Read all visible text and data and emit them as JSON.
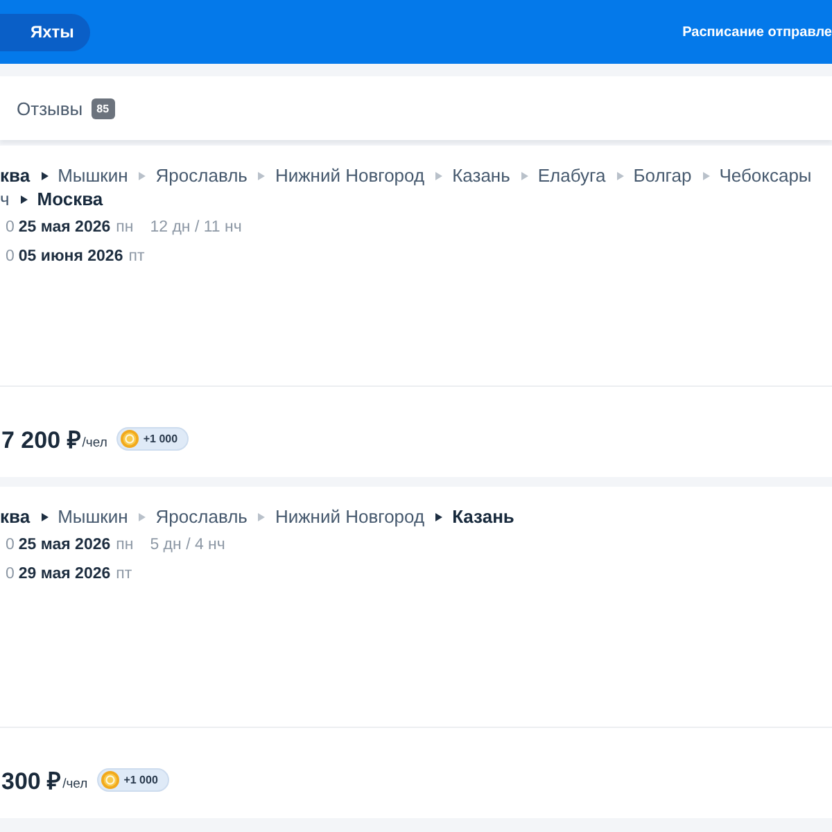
{
  "header": {
    "tabs": [
      {
        "label": "Яхты",
        "selected": true
      }
    ],
    "link": "Расписание отправле"
  },
  "subnav": {
    "tabs": [
      {
        "label": "Отзывы",
        "count": "85"
      }
    ]
  },
  "cruises": [
    {
      "route_lines": [
        [
          {
            "name": "ква",
            "terminal": true
          },
          {
            "name": "Мышкин",
            "terminal": false
          },
          {
            "name": "Ярославль",
            "terminal": false
          },
          {
            "name": "Нижний Новгород",
            "terminal": false
          },
          {
            "name": "Казань",
            "terminal": false
          },
          {
            "name": "Елабуга",
            "terminal": false
          },
          {
            "name": "Болгар",
            "terminal": false
          },
          {
            "name": "Чебоксары",
            "terminal": false
          }
        ],
        [
          {
            "name": "ч",
            "terminal": false
          },
          {
            "name": "Москва",
            "terminal": true
          }
        ]
      ],
      "departure": {
        "time": "0",
        "date": "25 мая 2026",
        "weekday": "пн"
      },
      "duration": "12 дн / 11 нч",
      "arrival": {
        "time": "0",
        "date": "05 июня 2026",
        "weekday": "пт"
      },
      "price": "7 200 ₽",
      "unit": "/чел",
      "bonus": "+1 000"
    },
    {
      "route_lines": [
        [
          {
            "name": "ква",
            "terminal": true
          },
          {
            "name": "Мышкин",
            "terminal": false
          },
          {
            "name": "Ярославль",
            "terminal": false
          },
          {
            "name": "Нижний Новгород",
            "terminal": false
          },
          {
            "name": "Казань",
            "terminal": true
          }
        ]
      ],
      "departure": {
        "time": "0",
        "date": "25 мая 2026",
        "weekday": "пн"
      },
      "duration": "5 дн / 4 нч",
      "arrival": {
        "time": "0",
        "date": "29 мая 2026",
        "weekday": "пт"
      },
      "price": "300 ₽",
      "unit": "/чел",
      "bonus": "+1 000"
    }
  ]
}
